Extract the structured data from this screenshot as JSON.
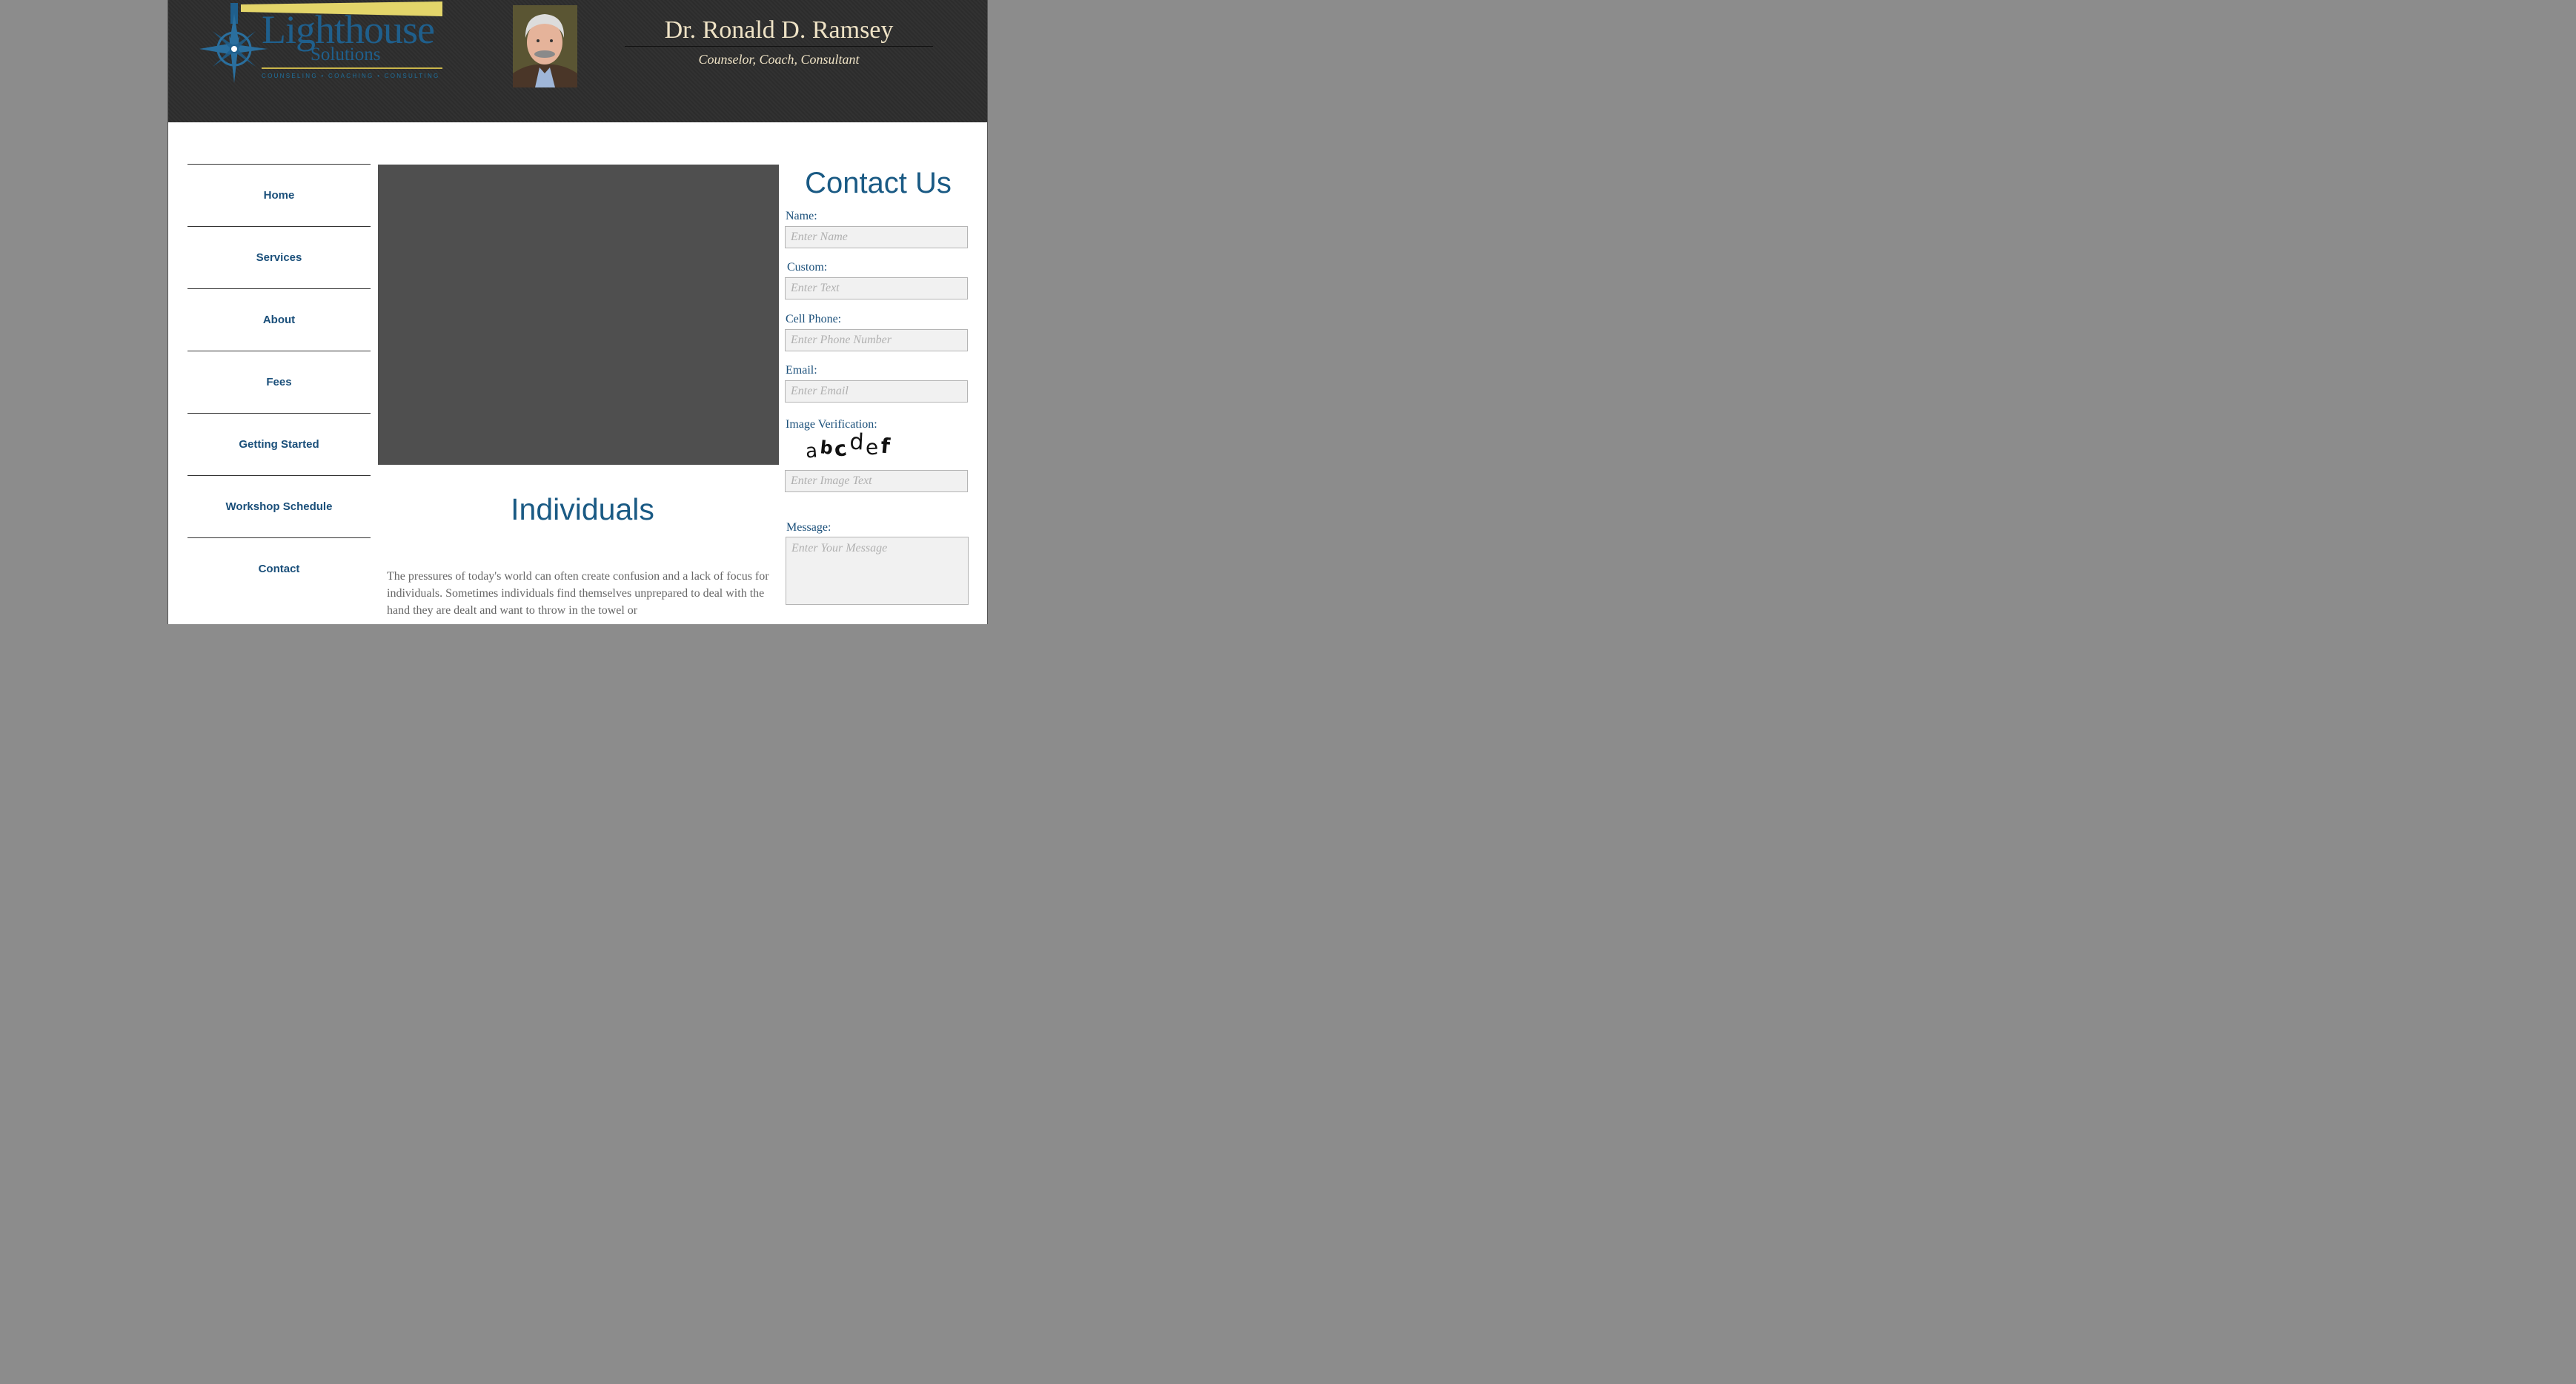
{
  "header": {
    "logo": {
      "word": "Lighthouse",
      "sub": "Solutions",
      "tagline": "COUNSELING • COACHING • CONSULTING"
    },
    "doctor_name": "Dr. Ronald D. Ramsey",
    "doctor_title": "Counselor, Coach, Consultant"
  },
  "nav": {
    "items": [
      {
        "label": "Home"
      },
      {
        "label": "Services"
      },
      {
        "label": "About"
      },
      {
        "label": "Fees"
      },
      {
        "label": "Getting Started"
      },
      {
        "label": "Workshop Schedule"
      },
      {
        "label": "Contact"
      }
    ]
  },
  "main": {
    "heading": "Individuals",
    "paragraph": "The pressures of today's world can often create confusion and a lack of focus for individuals.  Sometimes individuals find themselves unprepared to deal with the hand they are dealt and want to throw in the towel or"
  },
  "contact": {
    "title": "Contact Us",
    "name_label": "Name:",
    "name_placeholder": "Enter Name",
    "custom_label": "Custom:",
    "custom_placeholder": "Enter Text",
    "phone_label": "Cell Phone:",
    "phone_placeholder": "Enter Phone Number",
    "email_label": "Email:",
    "email_placeholder": "Enter Email",
    "captcha_label": "Image Verification:",
    "captcha_text": "abcdef",
    "captcha_placeholder": "Enter Image Text",
    "message_label": "Message:",
    "message_placeholder": "Enter Your Message"
  },
  "colors": {
    "brand_blue": "#1a5a84",
    "header_bg": "#2d2d2d",
    "header_text": "#efe3c6",
    "logo_beam": "#e3d56a",
    "hero_bg": "#4f4f4f"
  }
}
